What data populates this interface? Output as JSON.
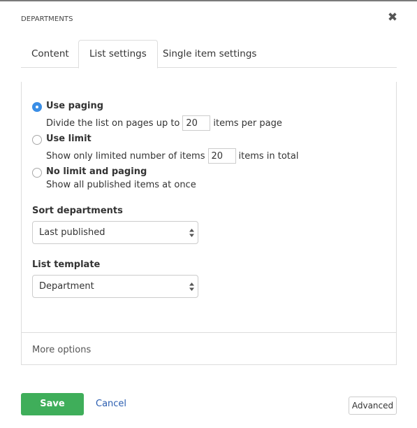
{
  "dialog": {
    "title": "DEPARTMENTS",
    "close_icon": "close-icon"
  },
  "tabs": [
    {
      "label": "Content",
      "active": false
    },
    {
      "label": "List settings",
      "active": true
    },
    {
      "label": "Single item settings",
      "active": false
    }
  ],
  "paging": {
    "options": [
      {
        "label": "Use paging",
        "checked": true,
        "desc_before": "Divide the list on pages up to",
        "value": "20",
        "desc_after": "items per page"
      },
      {
        "label": "Use limit",
        "checked": false,
        "desc_before": "Show only limited number of items",
        "value": "20",
        "desc_after": "items in total"
      },
      {
        "label": "No limit and paging",
        "checked": false,
        "desc_before": "Show all published items at once"
      }
    ]
  },
  "sort": {
    "label": "Sort departments",
    "selected": "Last published"
  },
  "template": {
    "label": "List template",
    "selected": "Department"
  },
  "more_options": "More options",
  "footer": {
    "save_label": "Save",
    "cancel_label": "Cancel",
    "advanced_label": "Advanced"
  },
  "colors": {
    "accent": "#3a8ee6",
    "save": "#3fae5a",
    "link": "#2a5db0"
  }
}
